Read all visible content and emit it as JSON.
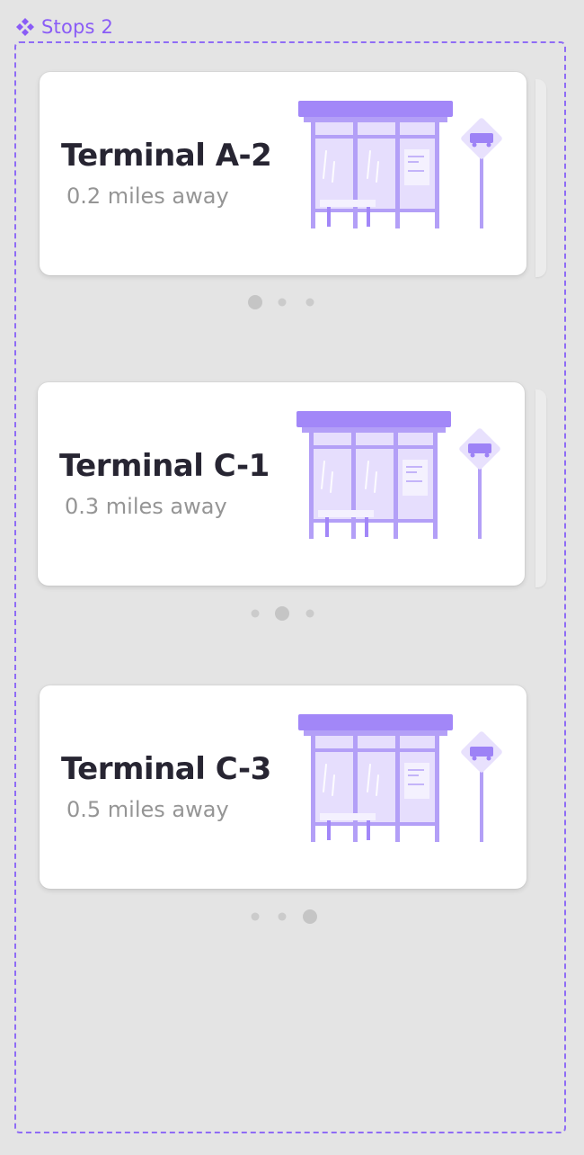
{
  "component": {
    "label": "Stops 2",
    "icon": "component-icon",
    "accent_color": "#8a5cf6"
  },
  "stops": [
    {
      "name": "Terminal A-2",
      "distance": "0.2 miles away",
      "active_dot": 0
    },
    {
      "name": "Terminal C-1",
      "distance": "0.3 miles away",
      "active_dot": 1
    },
    {
      "name": "Terminal C-3",
      "distance": "0.5 miles away",
      "active_dot": 2
    }
  ],
  "pagination": {
    "total_dots": 3
  },
  "colors": {
    "shelter_roof": "#a287f8",
    "shelter_frame": "#b39ff7",
    "shelter_glass": "#e6defd",
    "sign_bg": "#e8e1fd",
    "sign_icon": "#9d82f6",
    "title_text": "#272532",
    "subtitle_text": "#959595",
    "background": "#e4e4e4"
  }
}
